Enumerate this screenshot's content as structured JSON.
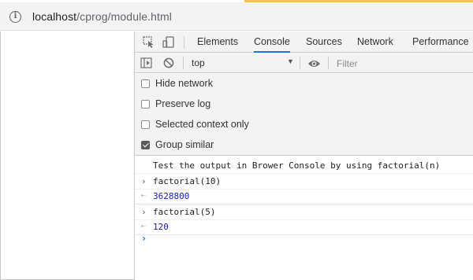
{
  "browser": {
    "url_host": "localhost",
    "url_path": "/cprog/module.html",
    "info_icon": "info-icon"
  },
  "devtools": {
    "tabs": [
      {
        "label": "Elements"
      },
      {
        "label": "Console"
      },
      {
        "label": "Sources"
      },
      {
        "label": "Network"
      },
      {
        "label": "Performance"
      }
    ],
    "active_tab": "Console",
    "toolbar_icons": [
      "inspect-element-icon",
      "device-toolbar-icon"
    ],
    "console_toolbar": {
      "sidebar_icon": "show-sidebar-icon",
      "clear_icon": "clear-console-icon",
      "context": "top",
      "eye_icon": "live-expression-eye-icon",
      "filter_placeholder": "Filter"
    },
    "settings": [
      {
        "label": "Hide network",
        "checked": false
      },
      {
        "label": "Preserve log",
        "checked": false
      },
      {
        "label": "Selected context only",
        "checked": false
      },
      {
        "label": "Group similar",
        "checked": true
      }
    ],
    "messages": [
      {
        "type": "log",
        "text": "Test the output in Brower Console by using factorial(n)"
      },
      {
        "type": "input",
        "text": "factorial(10)"
      },
      {
        "type": "result",
        "text": "3628800"
      },
      {
        "type": "input",
        "text": "factorial(5)"
      },
      {
        "type": "result",
        "text": "120"
      }
    ],
    "accent_color": "#1a73e8",
    "number_color": "#1a1aa6"
  }
}
